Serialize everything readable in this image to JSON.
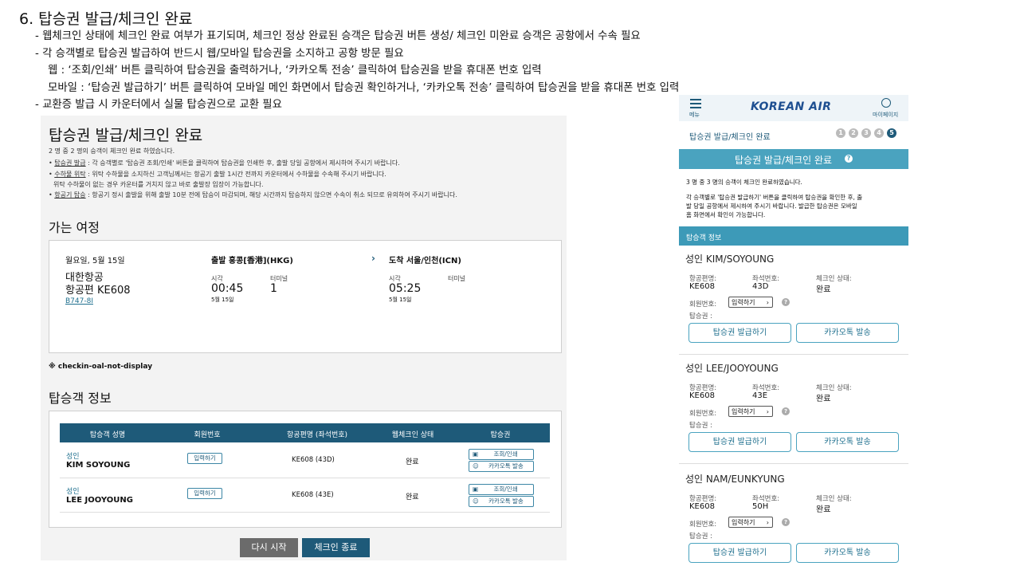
{
  "slide": {
    "title": "6. 탑승권 발급/체크인 완료",
    "bullets": [
      "- 웹체크인 상태에 체크인 완료 여부가 표기되며, 체크인 정상 완료된 승객은 탑승권 버튼 생성/ 체크인 미완료 승객은 공항에서 수속 필요",
      "- 각 승객별로 탑승권 발급하여 반드시 웹/모바일 탑승권을 소지하고 공항 방문 필요",
      "웹 : ‘조회/인쇄’ 버튼 클릭하여 탑승권을 출력하거나, ‘카카오톡 전송’ 클릭하여 탑승권을 받을 휴대폰 번호 입력",
      "모바일 : ‘탑승권 발급하기’ 버튼 클릭하여 모바일 메인 화면에서 탑승권 확인하거나, ‘카카오톡 전송’ 클릭하여 탑승권을 받을 휴대폰 번호 입력",
      "- 교환증 발급 시 카운터에서 실물 탑승권으로 교환 필요"
    ]
  },
  "desktop": {
    "title": "탑승권 발급/체크인 완료",
    "summary": "2 명 중 2 명의 승객이 체크인 완료 하였습니다.",
    "notes": [
      {
        "key": "탑승권 발급",
        "text": " : 각 승객별로 '탑승권 조회/인쇄' 버튼을 클릭하여 탑승권을 인쇄한 후, 출발 당일 공항에서 제시하여 주시기 바랍니다."
      },
      {
        "key": "수하물 위탁",
        "text": " : 위탁 수하물을 소지하신 고객님께서는 항공기 출발 1시간 전까지 카운터에서 수하물을 수속해 주시기 바랍니다."
      },
      {
        "key": "",
        "text": "위탁 수하물이 없는 경우 카운터를 거치지 않고 바로 출발장 입장이 가능합니다."
      },
      {
        "key": "항공기 탑승",
        "text": " : 항공기 정시 출발을 위해 출발 10분 전에 탑승이 마감되며, 해당 시간까지 탑승하지 않으면 수속이 취소 되므로 유의하여 주시기 바랍니다."
      }
    ],
    "itinerary_heading": "가는 여정",
    "itinerary": {
      "date": "월요일, 5월 15일",
      "airline": "대한항공",
      "flight": "항공편 KE608",
      "aircraft": "B747-8I",
      "depart_label": "출발 홍콩[香港](HKG)",
      "arrive_label": "도착 서울/인천(ICN)",
      "time_label": "시각",
      "terminal_label": "터미널",
      "depart_time": "00:45",
      "depart_date": "5월 15일",
      "depart_terminal": "1",
      "arrive_time": "05:25",
      "arrive_date": "5월 15일",
      "arrive_terminal": ""
    },
    "code_note": "※ checkin-oal-not-display",
    "passenger_heading": "탑승객 정보",
    "table_headers": [
      "탑승객 성명",
      "회원번호",
      "항공편명 (좌석번호)",
      "웹체크인 상태",
      "탑승권"
    ],
    "rows": [
      {
        "type": "성인",
        "name": "KIM SOYOUNG",
        "member_btn": "입력하기",
        "flight": "KE608 (43D)",
        "status": "완료",
        "btn1": "조회/인쇄",
        "btn2": "카카오톡 발송"
      },
      {
        "type": "성인",
        "name": "LEE JOOYOUNG",
        "member_btn": "입력하기",
        "flight": "KE608 (43E)",
        "status": "완료",
        "btn1": "조회/인쇄",
        "btn2": "카카오톡 발송"
      }
    ],
    "restart_btn": "다시 시작",
    "finish_btn": "체크인 종료"
  },
  "mobile": {
    "menu_label": "메뉴",
    "logo": "KOREAN AIR",
    "mypage_label": "마이페이지",
    "breadcrumb": "탑승권 발급/체크인 완료",
    "steps": [
      "1",
      "2",
      "3",
      "4",
      "5"
    ],
    "bar_title": "탑승권 발급/체크인 완료",
    "summary": "3 명 중 3 명의 승객이 체크인 완료하였습니다.",
    "info_line1": "각 승객별로 '탑승권 발급하기' 버튼을 클릭하여 탑승권을 확인한 후, 출",
    "info_line2": "발 당일 공항에서 제시하여 주시기 바랍니다. 발급한 탑승권은 모바일",
    "info_line3": "홈 화면에서 확인이 가능합니다.",
    "section_title": "탑승객 정보",
    "flight_label": "항공편명:",
    "seat_label": "좌석번호:",
    "status_label": "체크인 상태:",
    "member_label": "회원번호:",
    "boarding_label": "탑승권 :",
    "input_btn": "입력하기",
    "issue_btn": "탑승권 발급하기",
    "kakao_btn": "카카오톡 발송",
    "passengers": [
      {
        "name": "성인 KIM/SOYOUNG",
        "flight": "KE608",
        "seat": "43D",
        "status": "완료"
      },
      {
        "name": "성인 LEE/JOOYOUNG",
        "flight": "KE608",
        "seat": "43E",
        "status": "완료"
      },
      {
        "name": "성인 NAM/EUNKYUNG",
        "flight": "KE608",
        "seat": "50H",
        "status": "완료"
      }
    ]
  },
  "colors": {
    "navy": "#1e5a79",
    "teal": "#4aa3bf",
    "grey_btn": "#6b6b6b"
  }
}
